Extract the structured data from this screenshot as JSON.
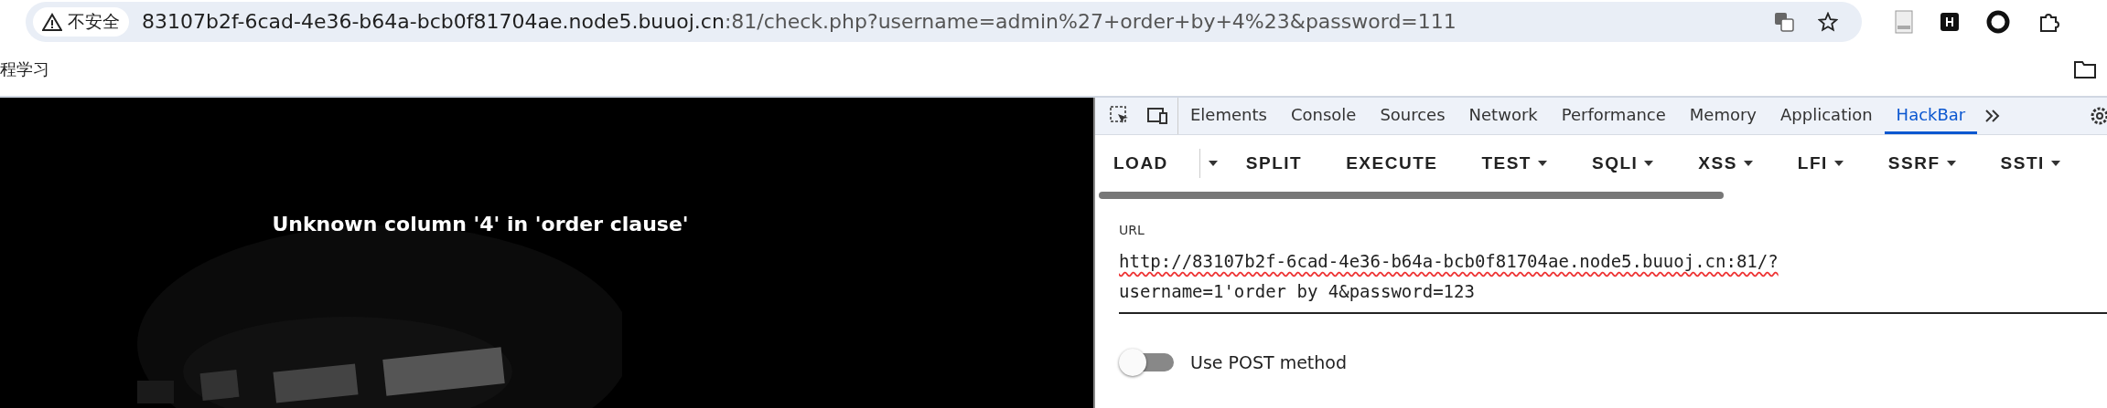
{
  "address_bar": {
    "security_label": "不安全",
    "url_host": "83107b2f-6cad-4e36-b64a-bcb0f81704ae.node5.buuoj.cn",
    "url_rest": ":81/check.php?username=admin%27+order+by+4%23&password=111"
  },
  "bookmarks": [
    "程学习"
  ],
  "page": {
    "message": "Unknown column '4' in 'order clause'"
  },
  "devtools": {
    "tabs": [
      {
        "label": "Elements",
        "selected": false
      },
      {
        "label": "Console",
        "selected": false
      },
      {
        "label": "Sources",
        "selected": false
      },
      {
        "label": "Network",
        "selected": false
      },
      {
        "label": "Performance",
        "selected": false
      },
      {
        "label": "Memory",
        "selected": false
      },
      {
        "label": "Application",
        "selected": false
      },
      {
        "label": "HackBar",
        "selected": true
      }
    ]
  },
  "hackbar": {
    "buttons": [
      {
        "label": "LOAD",
        "kind": "split"
      },
      {
        "label": "SPLIT",
        "kind": "plain"
      },
      {
        "label": "EXECUTE",
        "kind": "plain"
      },
      {
        "label": "TEST",
        "kind": "menu"
      },
      {
        "label": "SQLI",
        "kind": "menu"
      },
      {
        "label": "XSS",
        "kind": "menu"
      },
      {
        "label": "LFI",
        "kind": "menu"
      },
      {
        "label": "SSRF",
        "kind": "menu"
      },
      {
        "label": "SSTI",
        "kind": "menu"
      }
    ],
    "url_label": "URL",
    "url_lines": [
      "http://83107b2f-6cad-4e36-b64a-bcb0f81704ae.node5.buuoj.cn:81/?",
      "username=1'order by 4&password=123"
    ],
    "post_toggle": {
      "label": "Use POST method",
      "on": false
    }
  }
}
